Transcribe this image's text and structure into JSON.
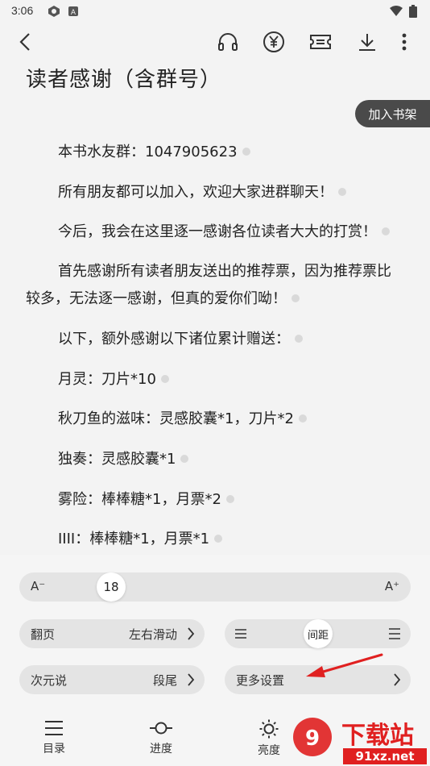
{
  "status": {
    "time": "3:06"
  },
  "toolbar": {
    "back_icon": "back-arrow-icon",
    "icons": [
      "headphones-icon",
      "yuan-coin-icon",
      "ticket-icon",
      "download-icon",
      "more-vertical-icon"
    ]
  },
  "article": {
    "title": "读者感谢（含群号）",
    "add_shelf_label": "加入书架",
    "paragraphs": [
      "本书水友群：1047905623",
      "所有朋友都可以加入，欢迎大家进群聊天！",
      "今后，我会在这里逐一感谢各位读者大大的打赏！",
      "首先感谢所有读者朋友送出的推荐票，因为推荐票比较多，无法逐一感谢，但真的爱你们呦！",
      "以下，额外感谢以下诸位累计赠送：",
      "月灵：刀片*10",
      "秋刀鱼的滋味：灵感胶囊*1，刀片*2",
      "独奏：灵感胶囊*1",
      "雾险：棒棒糖*1，月票*2",
      "IIII：棒棒糖*1，月票*1"
    ]
  },
  "settings": {
    "font_size": {
      "decrease_label": "A⁻",
      "increase_label": "A⁺",
      "value": "18"
    },
    "page_turn": {
      "label": "翻页",
      "value": "左右滑动"
    },
    "spacing": {
      "label": "间距"
    },
    "ciyuanshuo": {
      "label": "次元说",
      "value": "段尾"
    },
    "more_settings": {
      "label": "更多设置"
    }
  },
  "bottom_nav": {
    "toc_label": "目录",
    "progress_label": "进度",
    "brightness_label": "亮度"
  },
  "watermark": {
    "text1": "下载站",
    "text2": "91xz.net"
  },
  "colors": {
    "background": "#f3f3f3",
    "pill": "#e4e4e4",
    "dark_button": "#4a4a4a",
    "annotation_arrow": "#e02020"
  }
}
